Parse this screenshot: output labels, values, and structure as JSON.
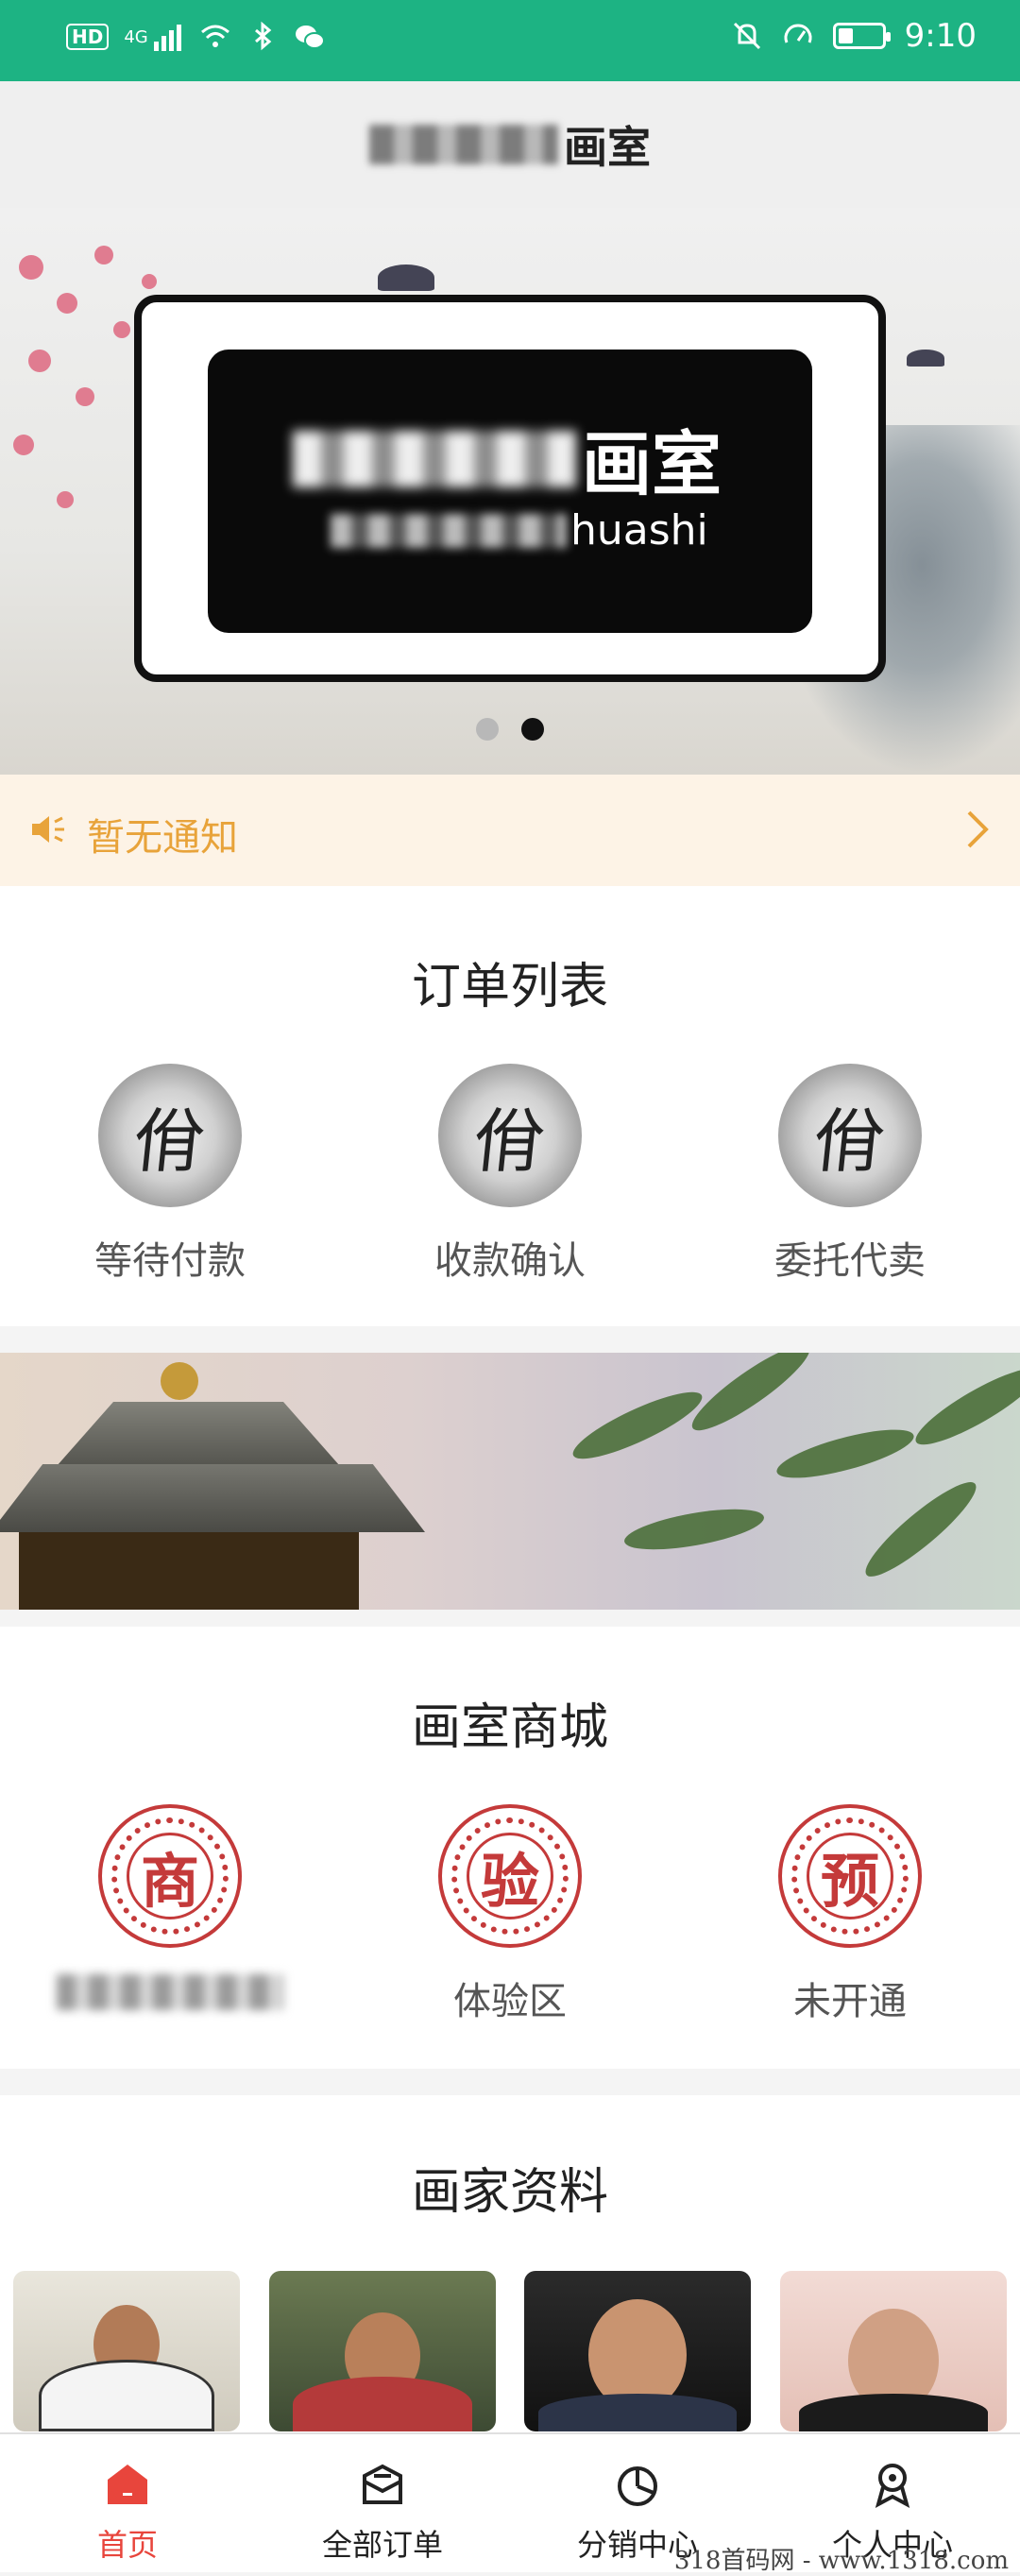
{
  "status_bar": {
    "time": "9:10",
    "network": "4G",
    "hd": "HD",
    "battery_level": 0.35,
    "icons": [
      "hd-icon",
      "signal-icon",
      "wifi-icon",
      "bluetooth-icon",
      "wechat-icon",
      "mute-icon",
      "speed-icon",
      "battery-icon"
    ]
  },
  "header": {
    "title_suffix": "画室"
  },
  "banner": {
    "title_suffix": "画室",
    "subtitle_suffix": "huashi",
    "slide_count": 2,
    "active_slide": 2
  },
  "notice": {
    "text": "暂无通知"
  },
  "orders": {
    "title": "订单列表",
    "items": [
      {
        "glyph": "佾",
        "label": "等待付款"
      },
      {
        "glyph": "佾",
        "label": "收款确认"
      },
      {
        "glyph": "佾",
        "label": "委托代卖"
      }
    ]
  },
  "mall": {
    "title": "画室商城",
    "items": [
      {
        "glyph": "商",
        "label": ""
      },
      {
        "glyph": "验",
        "label": "体验区"
      },
      {
        "glyph": "预",
        "label": "未开通"
      }
    ]
  },
  "artists": {
    "title": "画家资料"
  },
  "tabbar": {
    "items": [
      {
        "label": "首页",
        "active": true
      },
      {
        "label": "全部订单",
        "active": false
      },
      {
        "label": "分销中心",
        "active": false
      },
      {
        "label": "个人中心",
        "active": false
      }
    ]
  },
  "watermark": "318首码网 - www.1318.com",
  "colors": {
    "brand_green": "#1db383",
    "accent_red": "#e8453c",
    "notice_text": "#e8a33a",
    "notice_bg": "#fdf3e6"
  }
}
